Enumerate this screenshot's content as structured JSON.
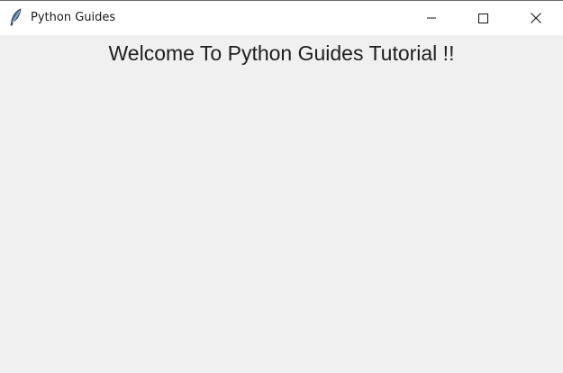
{
  "window": {
    "title": "Python Guides",
    "icon": "feather-icon",
    "controls": [
      "minimize-icon",
      "maximize-icon",
      "close-icon"
    ]
  },
  "main": {
    "heading": "Welcome To Python Guides Tutorial !!"
  },
  "colors": {
    "titlebar_bg": "#ffffff",
    "client_bg": "#f0f0f0",
    "text": "#1e1e1e"
  }
}
